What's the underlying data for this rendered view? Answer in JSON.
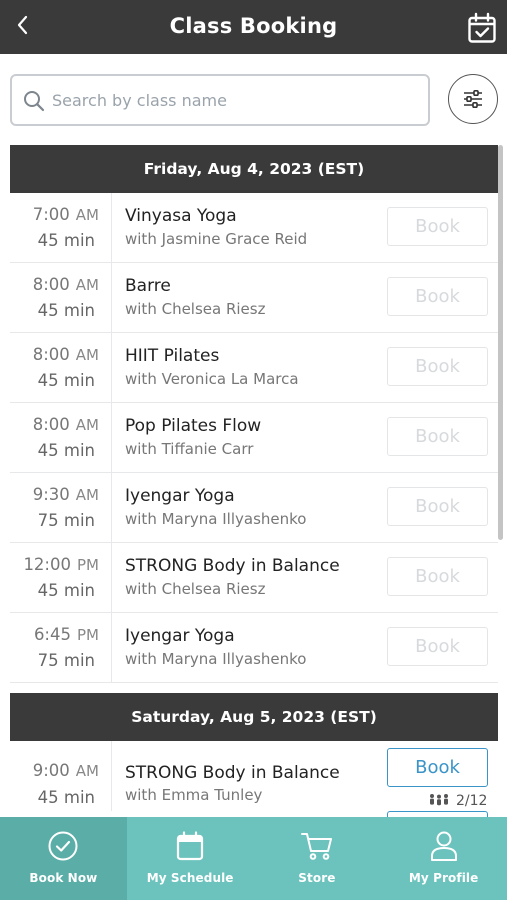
{
  "header": {
    "title": "Class Booking",
    "back_icon": "chevron-left-icon",
    "calendar_icon": "calendar-check-icon"
  },
  "search": {
    "placeholder": "Search by class name",
    "value": ""
  },
  "days": [
    {
      "label": "Friday, Aug 4, 2023 (EST)",
      "classes": [
        {
          "time": "7:00",
          "ampm": "AM",
          "duration": "45 min",
          "name": "Vinyasa Yoga",
          "instructor": "with Jasmine Grace Reid",
          "book_label": "Book"
        },
        {
          "time": "8:00",
          "ampm": "AM",
          "duration": "45 min",
          "name": "Barre",
          "instructor": "with Chelsea Riesz",
          "book_label": "Book"
        },
        {
          "time": "8:00",
          "ampm": "AM",
          "duration": "45 min",
          "name": "HIIT Pilates",
          "instructor": "with Veronica La Marca",
          "book_label": "Book"
        },
        {
          "time": "8:00",
          "ampm": "AM",
          "duration": "45 min",
          "name": "Pop Pilates Flow",
          "instructor": "with Tiffanie Carr",
          "book_label": "Book"
        },
        {
          "time": "9:30",
          "ampm": "AM",
          "duration": "75 min",
          "name": "Iyengar Yoga",
          "instructor": "with Maryna Illyashenko",
          "book_label": "Book"
        },
        {
          "time": "12:00",
          "ampm": "PM",
          "duration": "45 min",
          "name": "STRONG Body in Balance",
          "instructor": "with Chelsea Riesz",
          "book_label": "Book"
        },
        {
          "time": "6:45",
          "ampm": "PM",
          "duration": "75 min",
          "name": "Iyengar Yoga",
          "instructor": "with Maryna Illyashenko",
          "book_label": "Book"
        }
      ]
    },
    {
      "label": "Saturday, Aug 5, 2023 (EST)",
      "classes": [
        {
          "time": "9:00",
          "ampm": "AM",
          "duration": "45 min",
          "name": "STRONG Body in Balance",
          "instructor": "with Emma Tunley",
          "book_label": "Book",
          "spots": "2/12"
        }
      ]
    }
  ],
  "nav": [
    {
      "label": "Book Now",
      "icon": "check-circle-icon",
      "active": true
    },
    {
      "label": "My Schedule",
      "icon": "calendar-icon",
      "active": false
    },
    {
      "label": "Store",
      "icon": "cart-icon",
      "active": false
    },
    {
      "label": "My Profile",
      "icon": "person-icon",
      "active": false
    }
  ],
  "colors": {
    "header_bg": "#3a3a3a",
    "nav_bg": "#6cc3bd",
    "nav_active_bg": "#5aaea7",
    "book_active": "#3a94c8"
  }
}
